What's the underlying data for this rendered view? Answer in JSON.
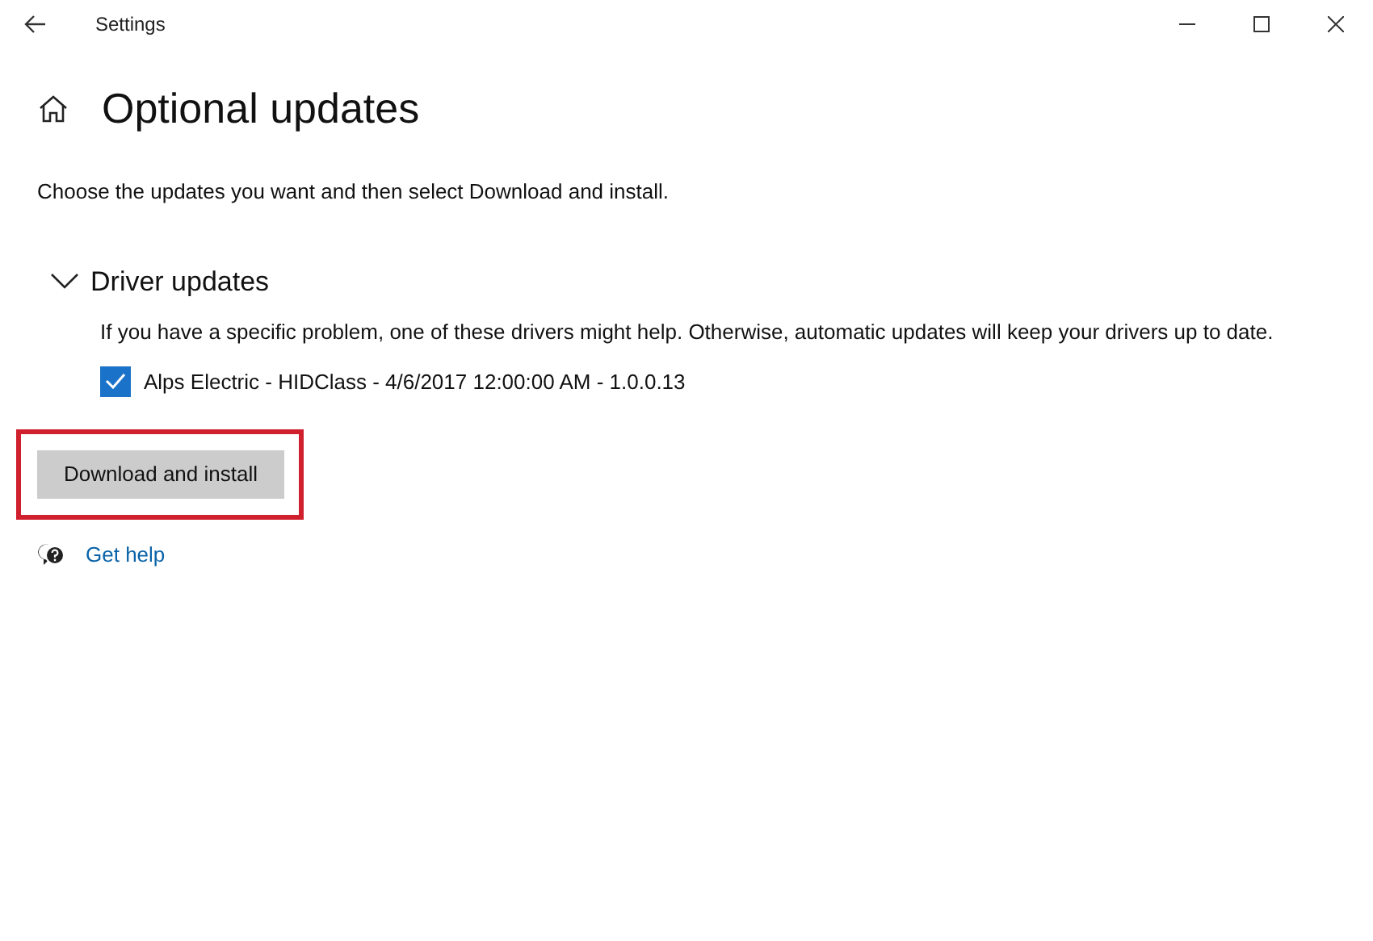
{
  "window": {
    "title": "Settings"
  },
  "page": {
    "title": "Optional updates",
    "description": "Choose the updates you want and then select Download and install."
  },
  "section": {
    "title": "Driver updates",
    "expanded": true,
    "description": "If you have a specific problem, one of these drivers might help. Otherwise, automatic updates will keep your drivers up to date.",
    "items": [
      {
        "label": "Alps Electric - HIDClass - 4/6/2017 12:00:00 AM - 1.0.0.13",
        "checked": true
      }
    ]
  },
  "button": {
    "label": "Download and install",
    "highlighted": true
  },
  "help_link": "Get help"
}
